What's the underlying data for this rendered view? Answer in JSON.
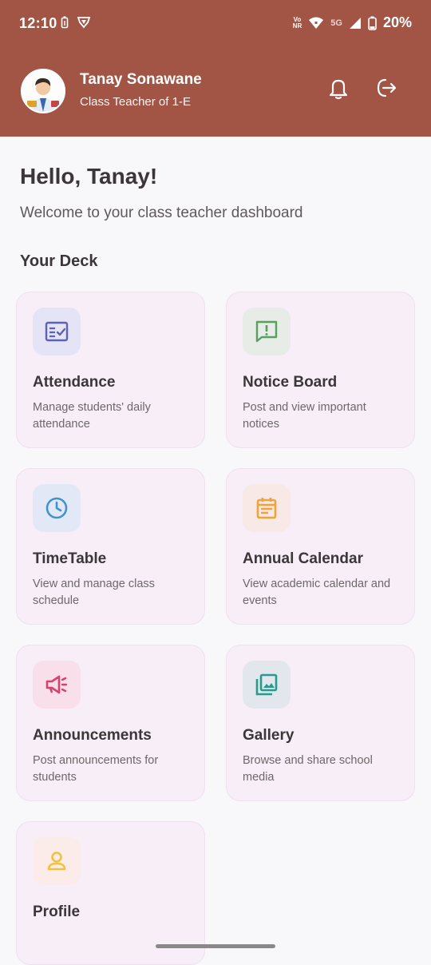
{
  "status_bar": {
    "time": "12:10",
    "volte_top": "Vo",
    "volte_bottom": "NR",
    "network": "5G",
    "battery": "20%"
  },
  "header": {
    "name": "Tanay Sonawane",
    "role": "Class Teacher of 1-E",
    "background_color": "#a25545"
  },
  "main": {
    "greeting": "Hello, Tanay!",
    "welcome": "Welcome to your class teacher dashboard",
    "section_title": "Your Deck"
  },
  "cards": [
    {
      "title": "Attendance",
      "desc": "Manage students' daily attendance",
      "icon": "attendance-icon",
      "color": "#5a63b8",
      "bg": "#e5e3f6"
    },
    {
      "title": "Notice Board",
      "desc": "Post and view important notices",
      "icon": "notice-icon",
      "color": "#55a15d",
      "bg": "#e7ece7"
    },
    {
      "title": "TimeTable",
      "desc": "View and manage class schedule",
      "icon": "clock-icon",
      "color": "#3f93d4",
      "bg": "#e2e8f6"
    },
    {
      "title": "Annual Calendar",
      "desc": "View academic calendar and events",
      "icon": "calendar-icon",
      "color": "#efa338",
      "bg": "#f8e8e6"
    },
    {
      "title": "Announcements",
      "desc": "Post announcements for students",
      "icon": "megaphone-icon",
      "color": "#d6426e",
      "bg": "#f8dfe9"
    },
    {
      "title": "Gallery",
      "desc": "Browse and share school media",
      "icon": "gallery-icon",
      "color": "#279c8d",
      "bg": "#e2e7ee"
    },
    {
      "title": "Profile",
      "desc": "",
      "icon": "profile-icon",
      "color": "#f1c23c",
      "bg": "#fbecea"
    }
  ]
}
